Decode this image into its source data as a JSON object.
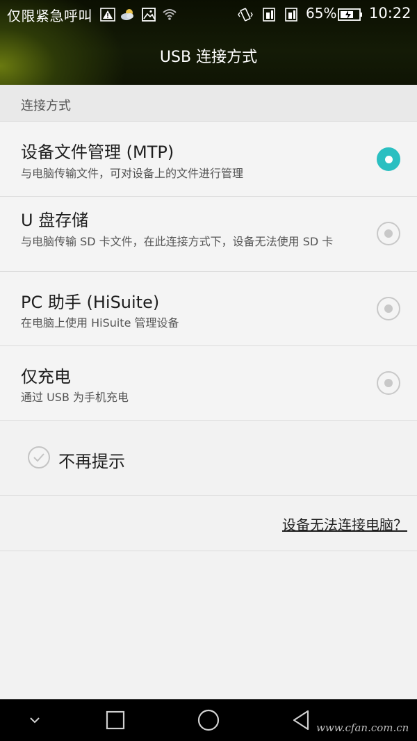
{
  "status_bar": {
    "carrier": "仅限紧急呼叫",
    "battery": "65%",
    "time": "10:22",
    "icons": [
      "warning-icon",
      "weather-icon",
      "image-icon",
      "wifi-icon",
      "vibrate-icon",
      "sim1-icon",
      "sim2-icon",
      "battery-icon"
    ]
  },
  "title": "USB 连接方式",
  "section_header": "连接方式",
  "options": [
    {
      "title": "设备文件管理 (MTP)",
      "desc": "与电脑传输文件，可对设备上的文件进行管理",
      "selected": true
    },
    {
      "title": "U 盘存储",
      "desc": "与电脑传输 SD 卡文件，在此连接方式下，设备无法使用 SD 卡",
      "selected": false
    },
    {
      "title": "PC 助手 (HiSuite)",
      "desc": "在电脑上使用 HiSuite 管理设备",
      "selected": false
    },
    {
      "title": "仅充电",
      "desc": "通过 USB 为手机充电",
      "selected": false
    }
  ],
  "dont_show_again": "不再提示",
  "help_link": "设备无法连接电脑？",
  "navbar": {
    "buttons": [
      "back-chevron-icon",
      "recents-icon",
      "home-icon",
      "back-icon"
    ]
  },
  "watermark": "www.cfan.com.cn",
  "colors": {
    "accent": "#2bbfc1",
    "header_bg": "#0f1404"
  }
}
